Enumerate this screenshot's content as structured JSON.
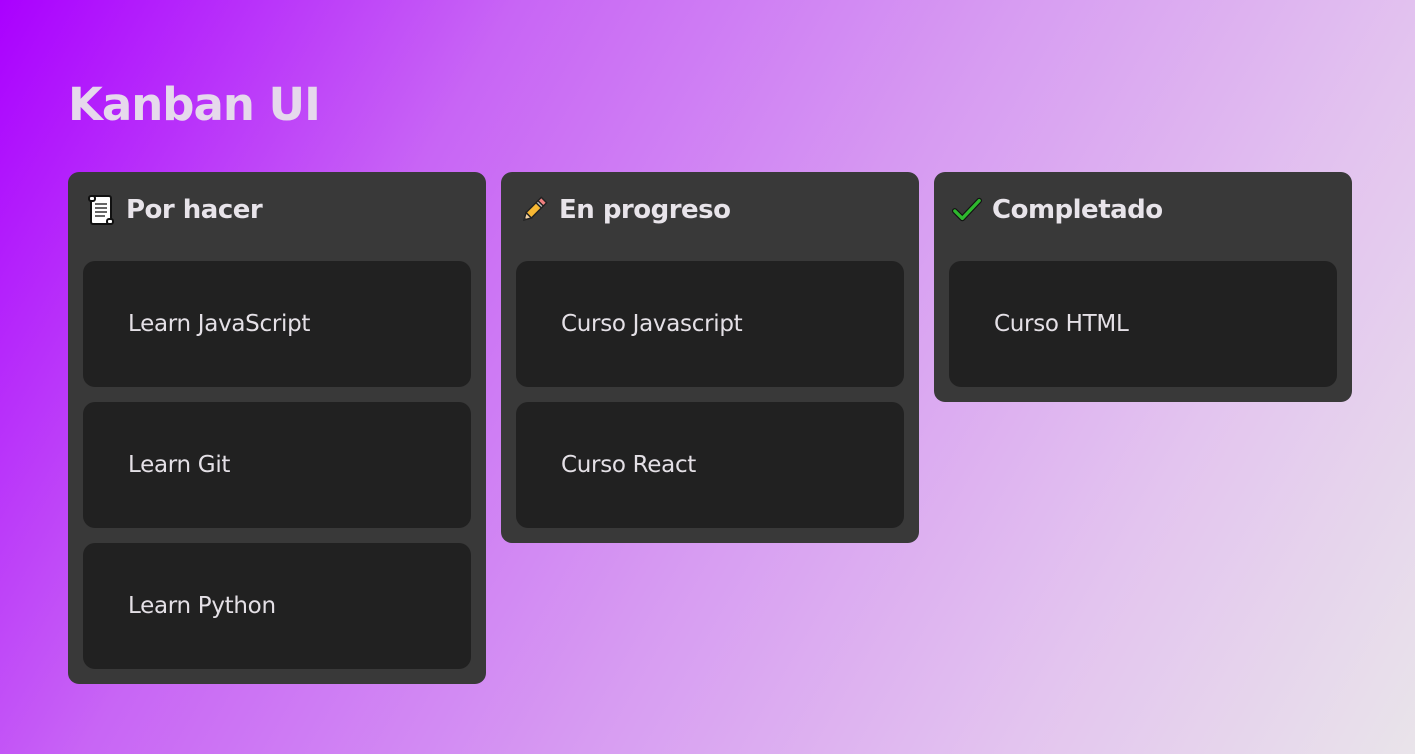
{
  "app": {
    "title": "Kanban UI"
  },
  "columns": [
    {
      "title": "Por hacer",
      "icon": "scroll-icon",
      "cards": [
        {
          "label": "Learn JavaScript"
        },
        {
          "label": "Learn Git"
        },
        {
          "label": "Learn Python"
        }
      ]
    },
    {
      "title": "En progreso",
      "icon": "pencil-icon",
      "cards": [
        {
          "label": "Curso Javascript"
        },
        {
          "label": "Curso React"
        }
      ]
    },
    {
      "title": "Completado",
      "icon": "check-mark-icon",
      "cards": [
        {
          "label": "Curso HTML"
        }
      ]
    }
  ],
  "colors": {
    "gradient_start": "#aa00ff",
    "gradient_end": "#e9e4ea",
    "column_bg": "#393939",
    "card_bg": "#212121",
    "text": "#e6e2e8",
    "check_green": "#2eb82e"
  }
}
